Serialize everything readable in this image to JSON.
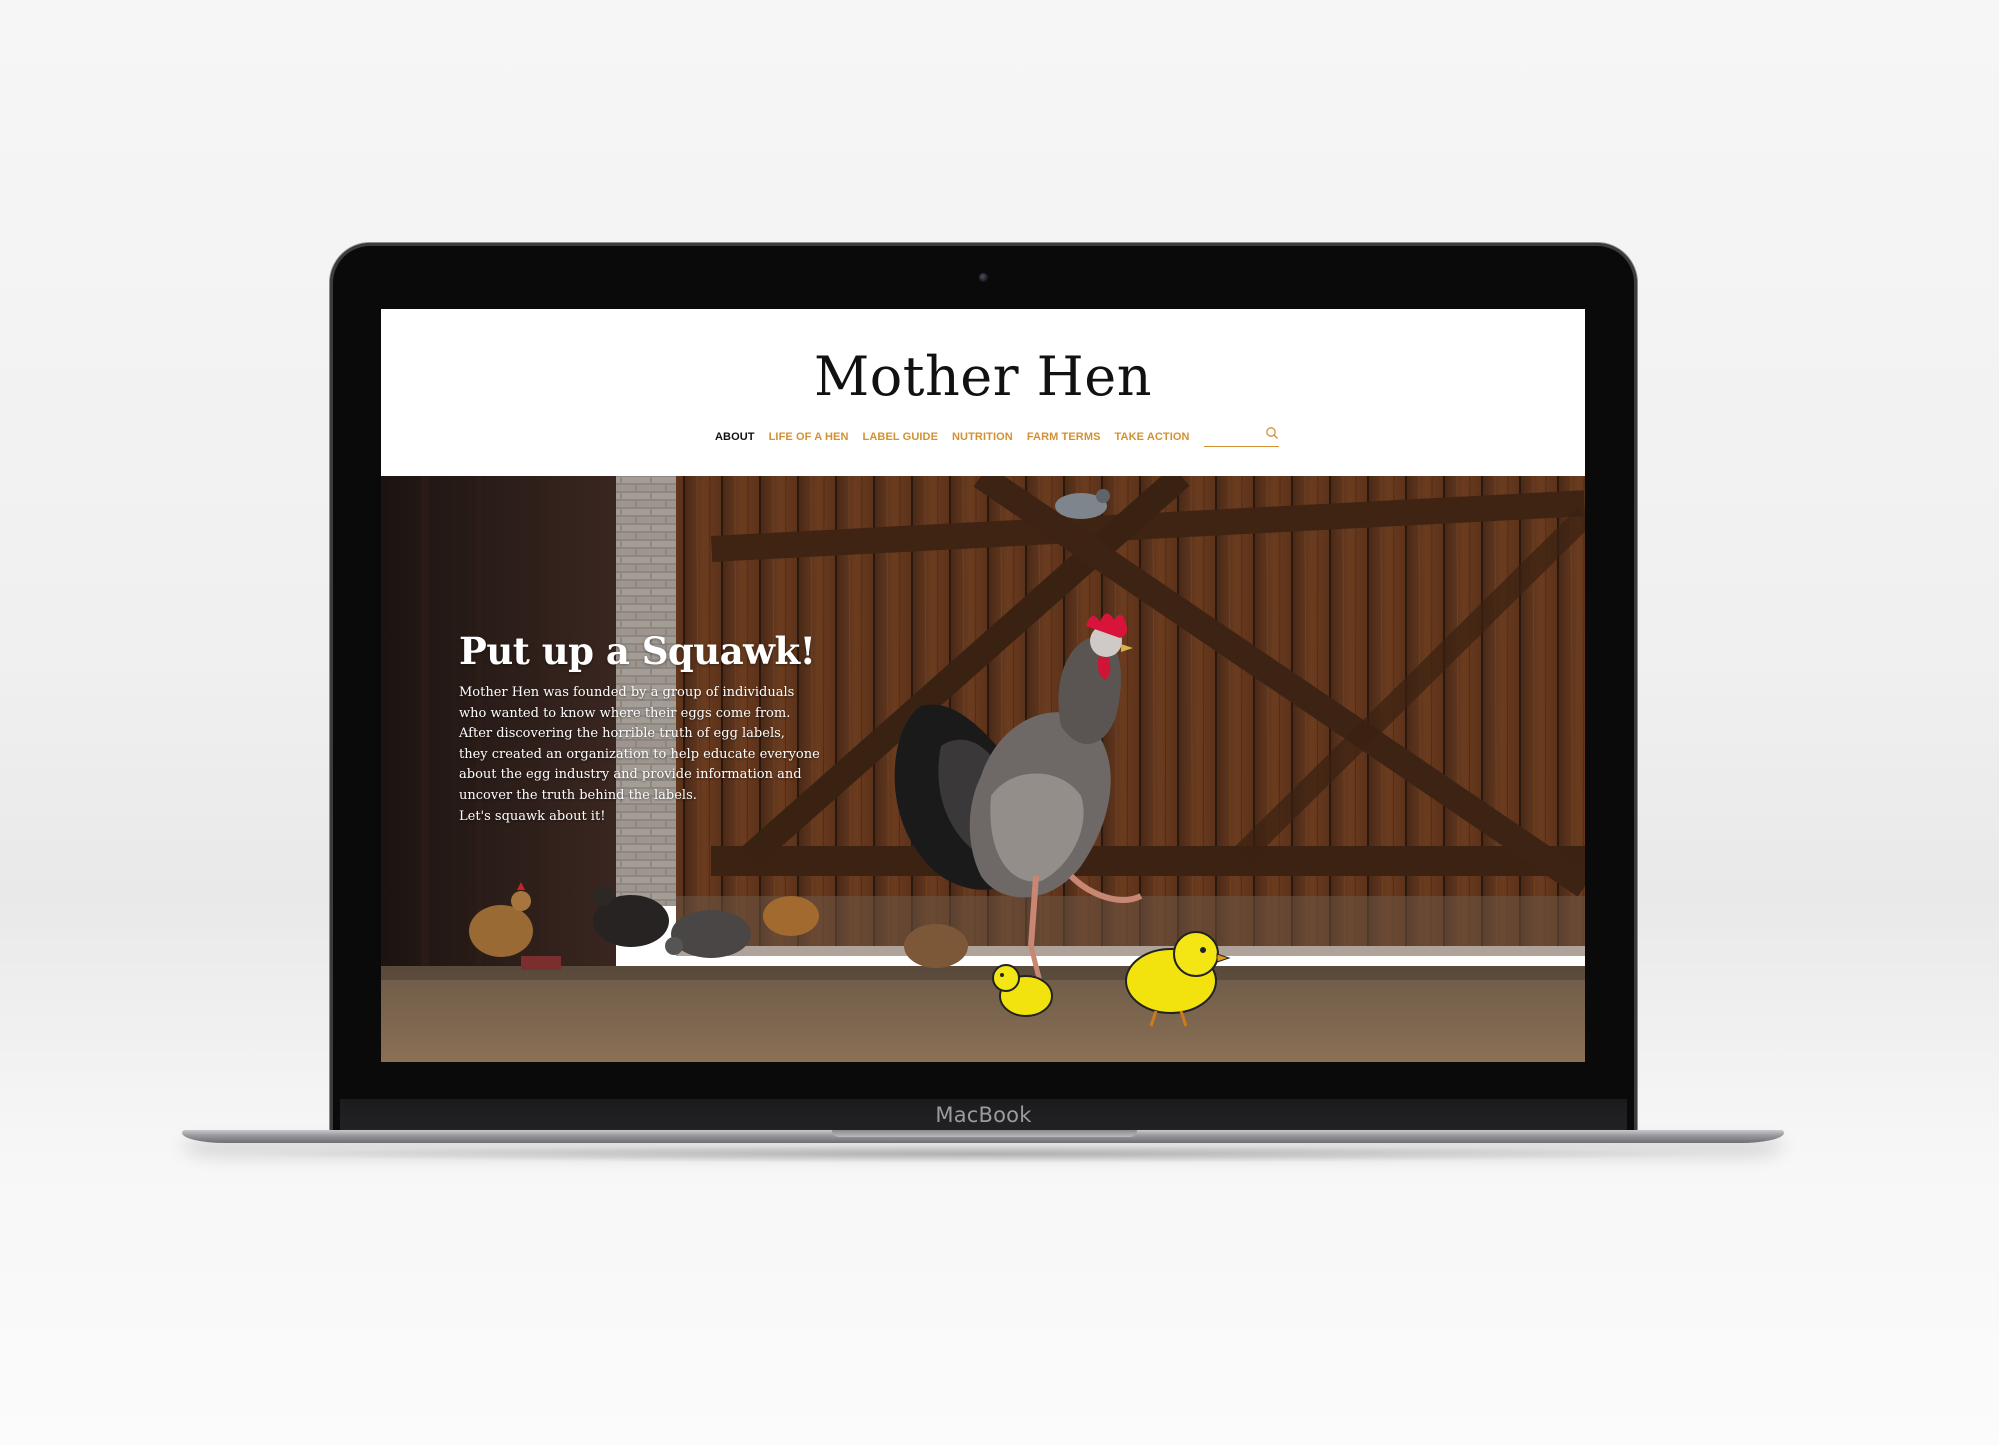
{
  "device": {
    "brand_label": "MacBook"
  },
  "site": {
    "logo": "Mother Hen",
    "nav": [
      {
        "label": "ABOUT",
        "active": true
      },
      {
        "label": "LIFE OF A HEN",
        "active": false
      },
      {
        "label": "LABEL GUIDE",
        "active": false
      },
      {
        "label": "NUTRITION",
        "active": false
      },
      {
        "label": "FARM TERMS",
        "active": false
      },
      {
        "label": "TAKE ACTION",
        "active": false
      }
    ],
    "search": {
      "value": "",
      "placeholder": "",
      "icon": "search-icon"
    },
    "colors": {
      "accent": "#d39133",
      "active_nav": "#111111"
    }
  },
  "hero": {
    "title": "Put up a Squawk!",
    "body_lines": [
      "Mother Hen was founded by a group of individuals",
      "who wanted to know where their eggs come from.",
      "After discovering the horrible truth of egg labels,",
      "they created an organization to help educate everyone",
      "about the egg industry and provide information and",
      "uncover the truth behind the labels.",
      "Let's squawk about it!"
    ]
  }
}
